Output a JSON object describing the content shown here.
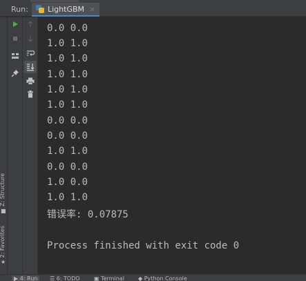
{
  "run_panel": {
    "label": "Run:",
    "tab": {
      "title": "LightGBM",
      "close_glyph": "×",
      "icon": "python-icon"
    }
  },
  "left_stripe": {
    "structure": "Z: Structure",
    "favorites": "2: Favorites"
  },
  "toolbar_left": [
    "run-icon",
    "stop-icon",
    "layout-icon",
    "pin-icon"
  ],
  "toolbar_right": [
    "up-arrow-icon",
    "down-arrow-icon",
    "soft-wrap-icon",
    "scroll-to-end-icon",
    "print-icon",
    "trash-icon"
  ],
  "console": {
    "lines": [
      "0.0 0.0",
      "1.0 1.0",
      "1.0 1.0",
      "1.0 1.0",
      "1.0 1.0",
      "1.0 1.0",
      "0.0 0.0",
      "0.0 0.0",
      "1.0 1.0",
      "0.0 0.0",
      "1.0 0.0",
      "1.0 1.0",
      "错误率: 0.07875",
      "",
      "Process finished with exit code 0"
    ]
  },
  "bottom_tabs": [
    {
      "label": "4: Run",
      "icon": "run-icon",
      "active": true
    },
    {
      "label": "6: TODO",
      "icon": "list-icon",
      "active": false
    },
    {
      "label": "Terminal",
      "icon": "terminal-icon",
      "active": false
    },
    {
      "label": "Python Console",
      "icon": "python-icon",
      "active": false
    }
  ],
  "colors": {
    "console_bg": "#2b2b2b",
    "panel_bg": "#3c3f41",
    "console_text": "#b9bcbf",
    "run_green": "#4eae4a",
    "accent_blue": "#4a88c7"
  }
}
